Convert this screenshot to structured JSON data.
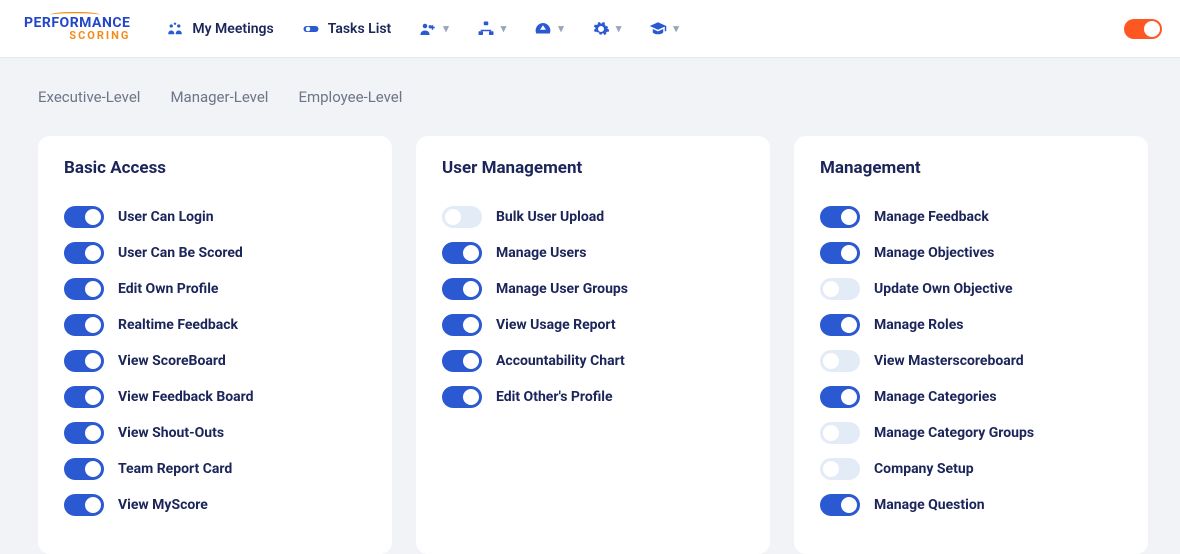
{
  "nav": {
    "my_meetings": "My Meetings",
    "tasks_list": "Tasks List"
  },
  "tabs": {
    "executive": "Executive-Level",
    "manager": "Manager-Level",
    "employee": "Employee-Level"
  },
  "cards": {
    "basic": {
      "title": "Basic Access",
      "items": [
        {
          "label": "User Can Login",
          "on": true
        },
        {
          "label": "User Can Be Scored",
          "on": true
        },
        {
          "label": "Edit Own Profile",
          "on": true
        },
        {
          "label": "Realtime Feedback",
          "on": true
        },
        {
          "label": "View ScoreBoard",
          "on": true
        },
        {
          "label": "View Feedback Board",
          "on": true
        },
        {
          "label": "View Shout-Outs",
          "on": true
        },
        {
          "label": "Team Report Card",
          "on": true
        },
        {
          "label": "View MyScore",
          "on": true
        }
      ]
    },
    "user_mgmt": {
      "title": "User Management",
      "items": [
        {
          "label": "Bulk User Upload",
          "on": false
        },
        {
          "label": "Manage Users",
          "on": true
        },
        {
          "label": "Manage User Groups",
          "on": true
        },
        {
          "label": "View Usage Report",
          "on": true
        },
        {
          "label": "Accountability Chart",
          "on": true
        },
        {
          "label": "Edit Other's Profile",
          "on": true
        }
      ]
    },
    "mgmt": {
      "title": "Management",
      "items": [
        {
          "label": "Manage Feedback",
          "on": true
        },
        {
          "label": "Manage Objectives",
          "on": true
        },
        {
          "label": "Update Own Objective",
          "on": false
        },
        {
          "label": "Manage Roles",
          "on": true
        },
        {
          "label": "View Masterscoreboard",
          "on": false
        },
        {
          "label": "Manage Categories",
          "on": true
        },
        {
          "label": "Manage Category Groups",
          "on": false
        },
        {
          "label": "Company Setup",
          "on": false
        },
        {
          "label": "Manage Question",
          "on": true
        }
      ]
    }
  }
}
